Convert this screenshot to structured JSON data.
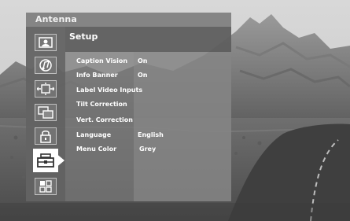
{
  "osd": {
    "window_title": "Antenna",
    "section_heading": "Setup"
  },
  "sidebar": {
    "items": [
      {
        "icon": "picture-icon"
      },
      {
        "icon": "audio-icon"
      },
      {
        "icon": "screen-format-icon"
      },
      {
        "icon": "pip-icon"
      },
      {
        "icon": "lock-icon"
      },
      {
        "icon": "setup-icon",
        "active": true
      },
      {
        "icon": "grid-icon"
      }
    ]
  },
  "settings": [
    {
      "label": "Caption Vision",
      "value": "On"
    },
    {
      "label": "Info Banner",
      "value": "On"
    },
    {
      "label": "Label Video Inputs",
      "value": ""
    },
    {
      "label": "Tilt Correction",
      "value": ""
    },
    {
      "label": "Vert. Correction",
      "value": ""
    },
    {
      "label": "Language",
      "value": "English"
    },
    {
      "label": "Menu Color",
      "value": "Grey"
    }
  ]
}
